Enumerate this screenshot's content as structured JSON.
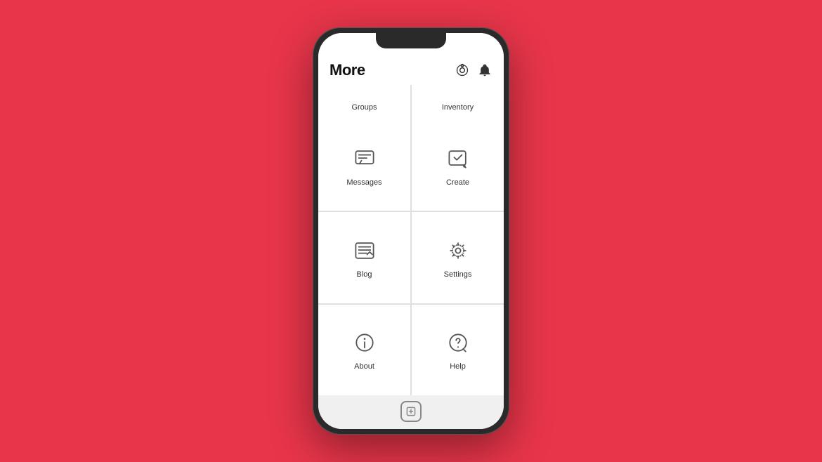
{
  "background_color": "#e8354a",
  "phone": {
    "header": {
      "title": "More",
      "camera_icon": "camera-icon",
      "bell_icon": "bell-icon"
    },
    "top_row": [
      {
        "label": "Groups",
        "icon": "groups-icon"
      },
      {
        "label": "Inventory",
        "icon": "inventory-icon"
      }
    ],
    "menu_items": [
      {
        "label": "Messages",
        "icon": "messages-icon"
      },
      {
        "label": "Create",
        "icon": "create-icon"
      },
      {
        "label": "Blog",
        "icon": "blog-icon"
      },
      {
        "label": "Settings",
        "icon": "settings-icon"
      },
      {
        "label": "About",
        "icon": "about-icon"
      },
      {
        "label": "Help",
        "icon": "help-icon"
      }
    ],
    "home_icon": "home-button-icon"
  }
}
